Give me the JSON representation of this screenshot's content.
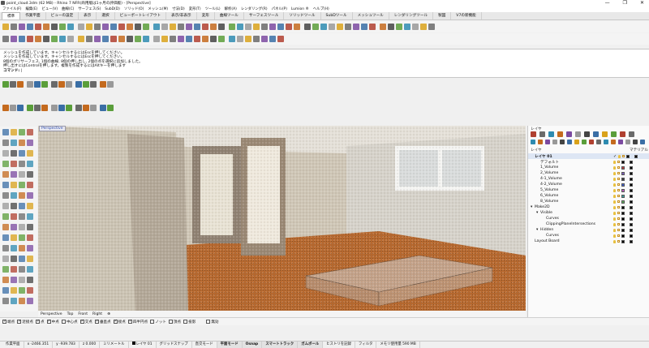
{
  "window": {
    "title": "point_cloud.3dm (62 MB) - Rhino 7 NFR(商用版は1ヶ月の評価版) - [Perspective]",
    "controls": [
      "—",
      "❐",
      "✕"
    ]
  },
  "menu": [
    "ファイル(F)",
    "編集(E)",
    "ビュー(V)",
    "曲線(C)",
    "サーフェス(S)",
    "SubD(D)",
    "ソリッド(O)",
    "メッシュ(M)",
    "寸法(D)",
    "変形(T)",
    "ツール(L)",
    "解析(A)",
    "レンダリング(R)",
    "パネル(P)",
    "Lumion ®",
    "ヘルプ(H)"
  ],
  "tabs": [
    "標準",
    "作業平面",
    "ビューの設定",
    "表示",
    "選択",
    "ビューポートレイアウト",
    "表示/非表示",
    "変形",
    "曲線ツール",
    "サーフェスツール",
    "ソリッドツール",
    "SubDツール",
    "メッシュツール",
    "レンダリングツール",
    "製図",
    "V7の新機能"
  ],
  "active_tab": "標準",
  "command_history": [
    "メッシュを作成しています。キャンセルするにはEscを押してください。",
    "メッシュを作成しています。キャンセルするにはEscを押してください。",
    "8個のポリサーフェス, 1個の曲線, 8個の押し出し, 2個の点を選択に追加しました。",
    "押し出すにはControlを押します。複製を作成するにはAltキーを押します"
  ],
  "command_prompt": "コマンド:",
  "viewport": {
    "label": "Perspective",
    "tabs": [
      "Perspective",
      "Top",
      "Front",
      "Right",
      "⊕"
    ]
  },
  "layer_panel": {
    "title": "レイヤ",
    "column_layer": "レイヤ",
    "column_material": "マテリアル",
    "layers": [
      {
        "name": "レイヤ 01",
        "indent": 0,
        "current": true,
        "color": "#000000"
      },
      {
        "name": "デフォルト",
        "indent": 1,
        "color": "#000000"
      },
      {
        "name": "1_Volume",
        "indent": 1,
        "color": "#c04040"
      },
      {
        "name": "2_Volume",
        "indent": 1,
        "color": "#8060c0"
      },
      {
        "name": "4-1_Volume",
        "indent": 1,
        "color": "#404040"
      },
      {
        "name": "4-2_Volume",
        "indent": 1,
        "color": "#4060d0"
      },
      {
        "name": "5_Volume",
        "indent": 1,
        "color": "#c060c0"
      },
      {
        "name": "6_Volume",
        "indent": 1,
        "color": "#40a0a0"
      },
      {
        "name": "8_Volume",
        "indent": 1,
        "color": "#60b060"
      },
      {
        "name": "Make2D",
        "indent": 0,
        "expand": "▾",
        "color": "#000000"
      },
      {
        "name": "Visible",
        "indent": 1,
        "expand": "▾",
        "color": "#000000"
      },
      {
        "name": "Curves",
        "indent": 2,
        "color": "#000000"
      },
      {
        "name": "ClippingPlaneIntersections",
        "indent": 2,
        "color": "#000000"
      },
      {
        "name": "Hidden",
        "indent": 1,
        "expand": "▾",
        "color": "#000000"
      },
      {
        "name": "Curves",
        "indent": 2,
        "color": "#000000"
      },
      {
        "name": "Layout Board",
        "indent": 0,
        "color": "#000000"
      }
    ]
  },
  "osnaps": [
    {
      "label": "端点",
      "on": true
    },
    {
      "label": "近接点",
      "on": true
    },
    {
      "label": "点",
      "on": true
    },
    {
      "label": "中点",
      "on": true
    },
    {
      "label": "中心点",
      "on": false
    },
    {
      "label": "交点",
      "on": true
    },
    {
      "label": "垂直点",
      "on": true
    },
    {
      "label": "接点",
      "on": true
    },
    {
      "label": "四半円点",
      "on": true
    },
    {
      "label": "ノット",
      "on": false
    },
    {
      "label": "頂点",
      "on": false
    },
    {
      "label": "投影",
      "on": false
    },
    {
      "label": "無効",
      "on": false
    }
  ],
  "status": {
    "cplane": "作業平面",
    "x": "x -2466.351",
    "y": "y -939.783",
    "z": "z 0.000",
    "units": "ミリメートル",
    "layer": "レイヤ 01",
    "toggles": [
      "グリッドスナップ",
      "直交モード",
      "平面モード",
      "Osnap",
      "スマートトラック",
      "ガムボール",
      "ヒストリを記録",
      "フィルタ",
      "メモリ使用量 590 MB"
    ],
    "active_toggles": [
      "平面モード",
      "Osnap",
      "スマートトラック",
      "ガムボール"
    ]
  }
}
